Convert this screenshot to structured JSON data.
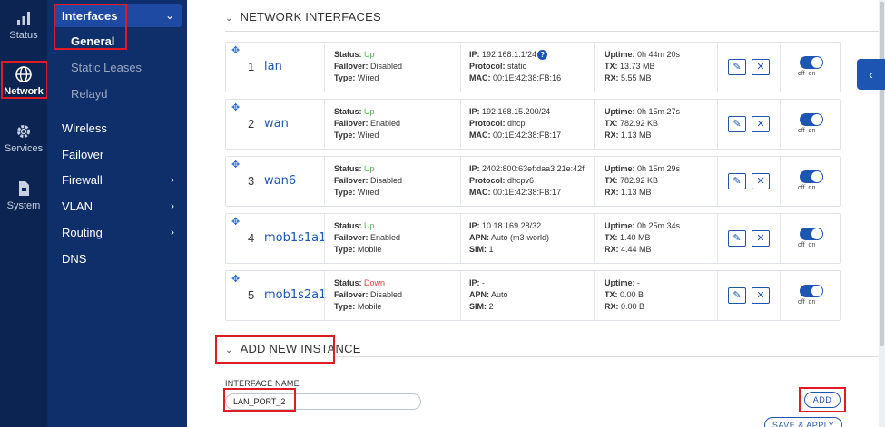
{
  "rail": {
    "items": [
      {
        "label": "Status",
        "icon": "bar-chart-icon"
      },
      {
        "label": "Network",
        "icon": "globe-icon"
      },
      {
        "label": "Services",
        "icon": "gear-icon"
      },
      {
        "label": "System",
        "icon": "file-icon"
      }
    ]
  },
  "subnav": {
    "interfaces": "Interfaces",
    "general": "General",
    "static_leases": "Static Leases",
    "relayd": "Relayd",
    "wireless": "Wireless",
    "failover": "Failover",
    "firewall": "Firewall",
    "vlan": "VLAN",
    "routing": "Routing",
    "dns": "DNS"
  },
  "main": {
    "network_interfaces_title": "NETWORK INTERFACES",
    "add_new_instance_title": "ADD NEW INSTANCE",
    "interface_name_label": "INTERFACE NAME",
    "interface_name_value": "LAN_PORT_2",
    "add_button": "ADD",
    "save_apply_button": "SAVE & APPLY",
    "toggle_off": "off",
    "toggle_on": "on",
    "labels": {
      "status": "Status:",
      "failover": "Failover:",
      "type": "Type:",
      "ip": "IP:",
      "protocol": "Protocol:",
      "apn": "APN:",
      "mac": "MAC:",
      "sim": "SIM:",
      "uptime": "Uptime:",
      "tx": "TX:",
      "rx": "RX:"
    },
    "interfaces": [
      {
        "num": "1",
        "name": "lan",
        "status": "Up",
        "failover": "Disabled",
        "type": "Wired",
        "ip": "192.168.1.1/24",
        "mid_label": "Protocol:",
        "mid_value": "static",
        "bot_label": "MAC:",
        "bot_value": "00:1E:42:38:FB:16",
        "uptime": "0h 44m 20s",
        "tx": "13.73 MB",
        "rx": "5.55 MB"
      },
      {
        "num": "2",
        "name": "wan",
        "status": "Up",
        "failover": "Enabled",
        "type": "Wired",
        "ip": "192.168.15.200/24",
        "mid_label": "Protocol:",
        "mid_value": "dhcp",
        "bot_label": "MAC:",
        "bot_value": "00:1E:42:38:FB:17",
        "uptime": "0h 15m 27s",
        "tx": "782.92 KB",
        "rx": "1.13 MB"
      },
      {
        "num": "3",
        "name": "wan6",
        "status": "Up",
        "failover": "Disabled",
        "type": "Wired",
        "ip": "2402:800:63ef:daa3:21e:42f",
        "mid_label": "Protocol:",
        "mid_value": "dhcpv6",
        "bot_label": "MAC:",
        "bot_value": "00:1E:42:38:FB:17",
        "uptime": "0h 15m 29s",
        "tx": "782.92 KB",
        "rx": "1.13 MB"
      },
      {
        "num": "4",
        "name": "mob1s1a1",
        "status": "Up",
        "failover": "Enabled",
        "type": "Mobile",
        "ip": "10.18.169.28/32",
        "mid_label": "APN:",
        "mid_value": "Auto (m3-world)",
        "bot_label": "SIM:",
        "bot_value": "1",
        "uptime": "0h 25m 34s",
        "tx": "1.40 MB",
        "rx": "4.44 MB"
      },
      {
        "num": "5",
        "name": "mob1s2a1",
        "status": "Down",
        "failover": "Disabled",
        "type": "Mobile",
        "ip": "-",
        "mid_label": "APN:",
        "mid_value": "Auto",
        "bot_label": "SIM:",
        "bot_value": "2",
        "uptime": "-",
        "tx": "0.00 B",
        "rx": "0.00 B"
      }
    ]
  },
  "colors": {
    "rail_bg": "#0b2451",
    "subnav_bg": "#0f2f6b",
    "accent": "#1d55b3",
    "status_up": "#4caf50",
    "status_down": "#e53935",
    "highlight": "#e01b24"
  }
}
